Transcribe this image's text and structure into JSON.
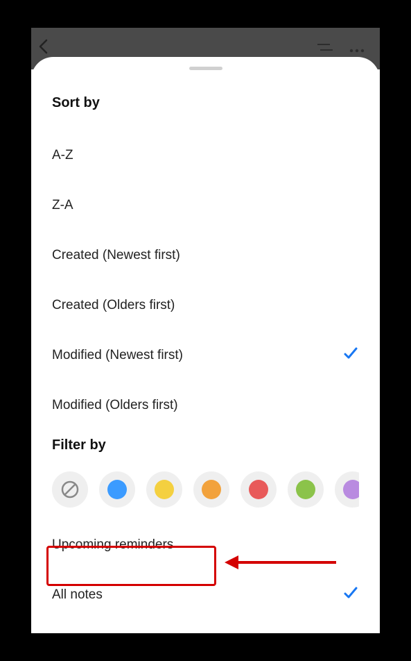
{
  "sortSection": {
    "title": "Sort by",
    "options": [
      {
        "label": "A-Z",
        "selected": false
      },
      {
        "label": "Z-A",
        "selected": false
      },
      {
        "label": "Created (Newest first)",
        "selected": false
      },
      {
        "label": "Created (Olders first)",
        "selected": false
      },
      {
        "label": "Modified (Newest first)",
        "selected": true
      },
      {
        "label": "Modified (Olders first)",
        "selected": false
      }
    ]
  },
  "filterSection": {
    "title": "Filter by",
    "colors": [
      {
        "name": "none",
        "color": "none"
      },
      {
        "name": "blue",
        "color": "#3b9bff"
      },
      {
        "name": "yellow",
        "color": "#f4d040"
      },
      {
        "name": "orange",
        "color": "#f2a23c"
      },
      {
        "name": "red",
        "color": "#e85a5a"
      },
      {
        "name": "green",
        "color": "#8bc34a"
      },
      {
        "name": "purple",
        "color": "#b98be0"
      }
    ],
    "options": [
      {
        "label": "Upcoming reminders",
        "selected": false
      },
      {
        "label": "All notes",
        "selected": true
      }
    ]
  },
  "annotation": {
    "highlight_target": "Upcoming reminders"
  }
}
